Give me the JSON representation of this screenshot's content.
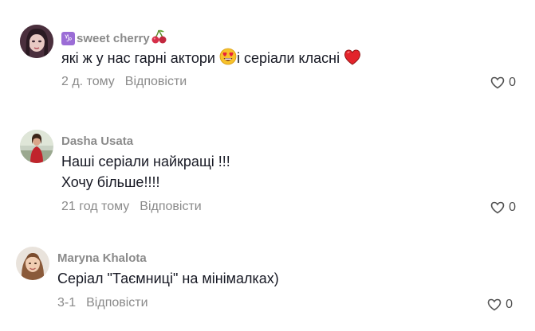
{
  "comments": [
    {
      "username": "sweet cherry",
      "zodiac_glyph": "♑",
      "lines": [
        "які ж у нас гарні актори ",
        "і серіали класні "
      ],
      "time": "2 д. тому",
      "reply_label": "Відповісти",
      "likes": "0",
      "emoji": [
        "cherries-icon",
        "heart-eyes-emoji",
        "red-heart-emoji"
      ]
    },
    {
      "username": "Dasha Usata",
      "lines": [
        "Наші серіали найкращі !!!",
        "Хочу більше!!!!"
      ],
      "time": "21 год тому",
      "reply_label": "Відповісти",
      "likes": "0"
    },
    {
      "username": "Maryna Khalota",
      "lines": [
        "Серіал \"Таємниці\" на мінімалках)"
      ],
      "time": "3-1",
      "reply_label": "Відповісти",
      "likes": "0"
    }
  ],
  "colors": {
    "text": "#161823",
    "muted": "#8a8a8a",
    "zodiac_bg": "#9b6dd6"
  }
}
